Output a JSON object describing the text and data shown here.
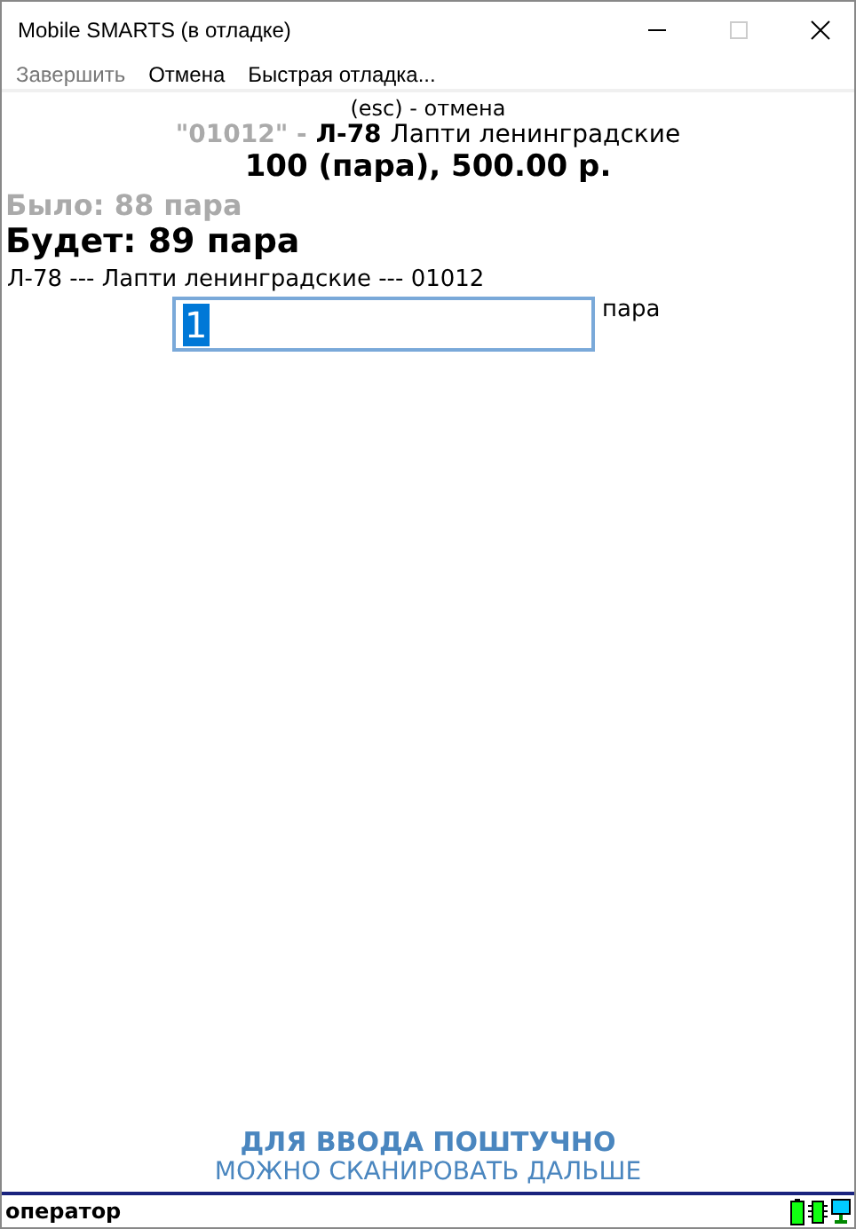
{
  "window": {
    "title": "Mobile SMARTS (в отладке)"
  },
  "menu": [
    {
      "label": "Завершить",
      "disabled": true
    },
    {
      "label": "Отмена",
      "disabled": false
    },
    {
      "label": "Быстрая отладка...",
      "disabled": false
    }
  ],
  "header": {
    "hint": "(esc) - отмена",
    "code": "\"01012\" -",
    "article": "Л-78",
    "name": "Лапти ленинградские",
    "price": "100 (пара), 500.00 р."
  },
  "was": "Было: 88 пара",
  "will": "Будет: 89 пара",
  "description": "Л-78 --- Лапти ленинградские --- 01012",
  "quantity": {
    "value": "1",
    "selected": true,
    "unit": "пара"
  },
  "footer": {
    "title": "ДЛЯ ВВОДА ПОШТУЧНО",
    "subtitle": "МОЖНО СКАНИРОВАТЬ ДАЛЬШЕ"
  },
  "status_bar": {
    "user": "оператор"
  }
}
